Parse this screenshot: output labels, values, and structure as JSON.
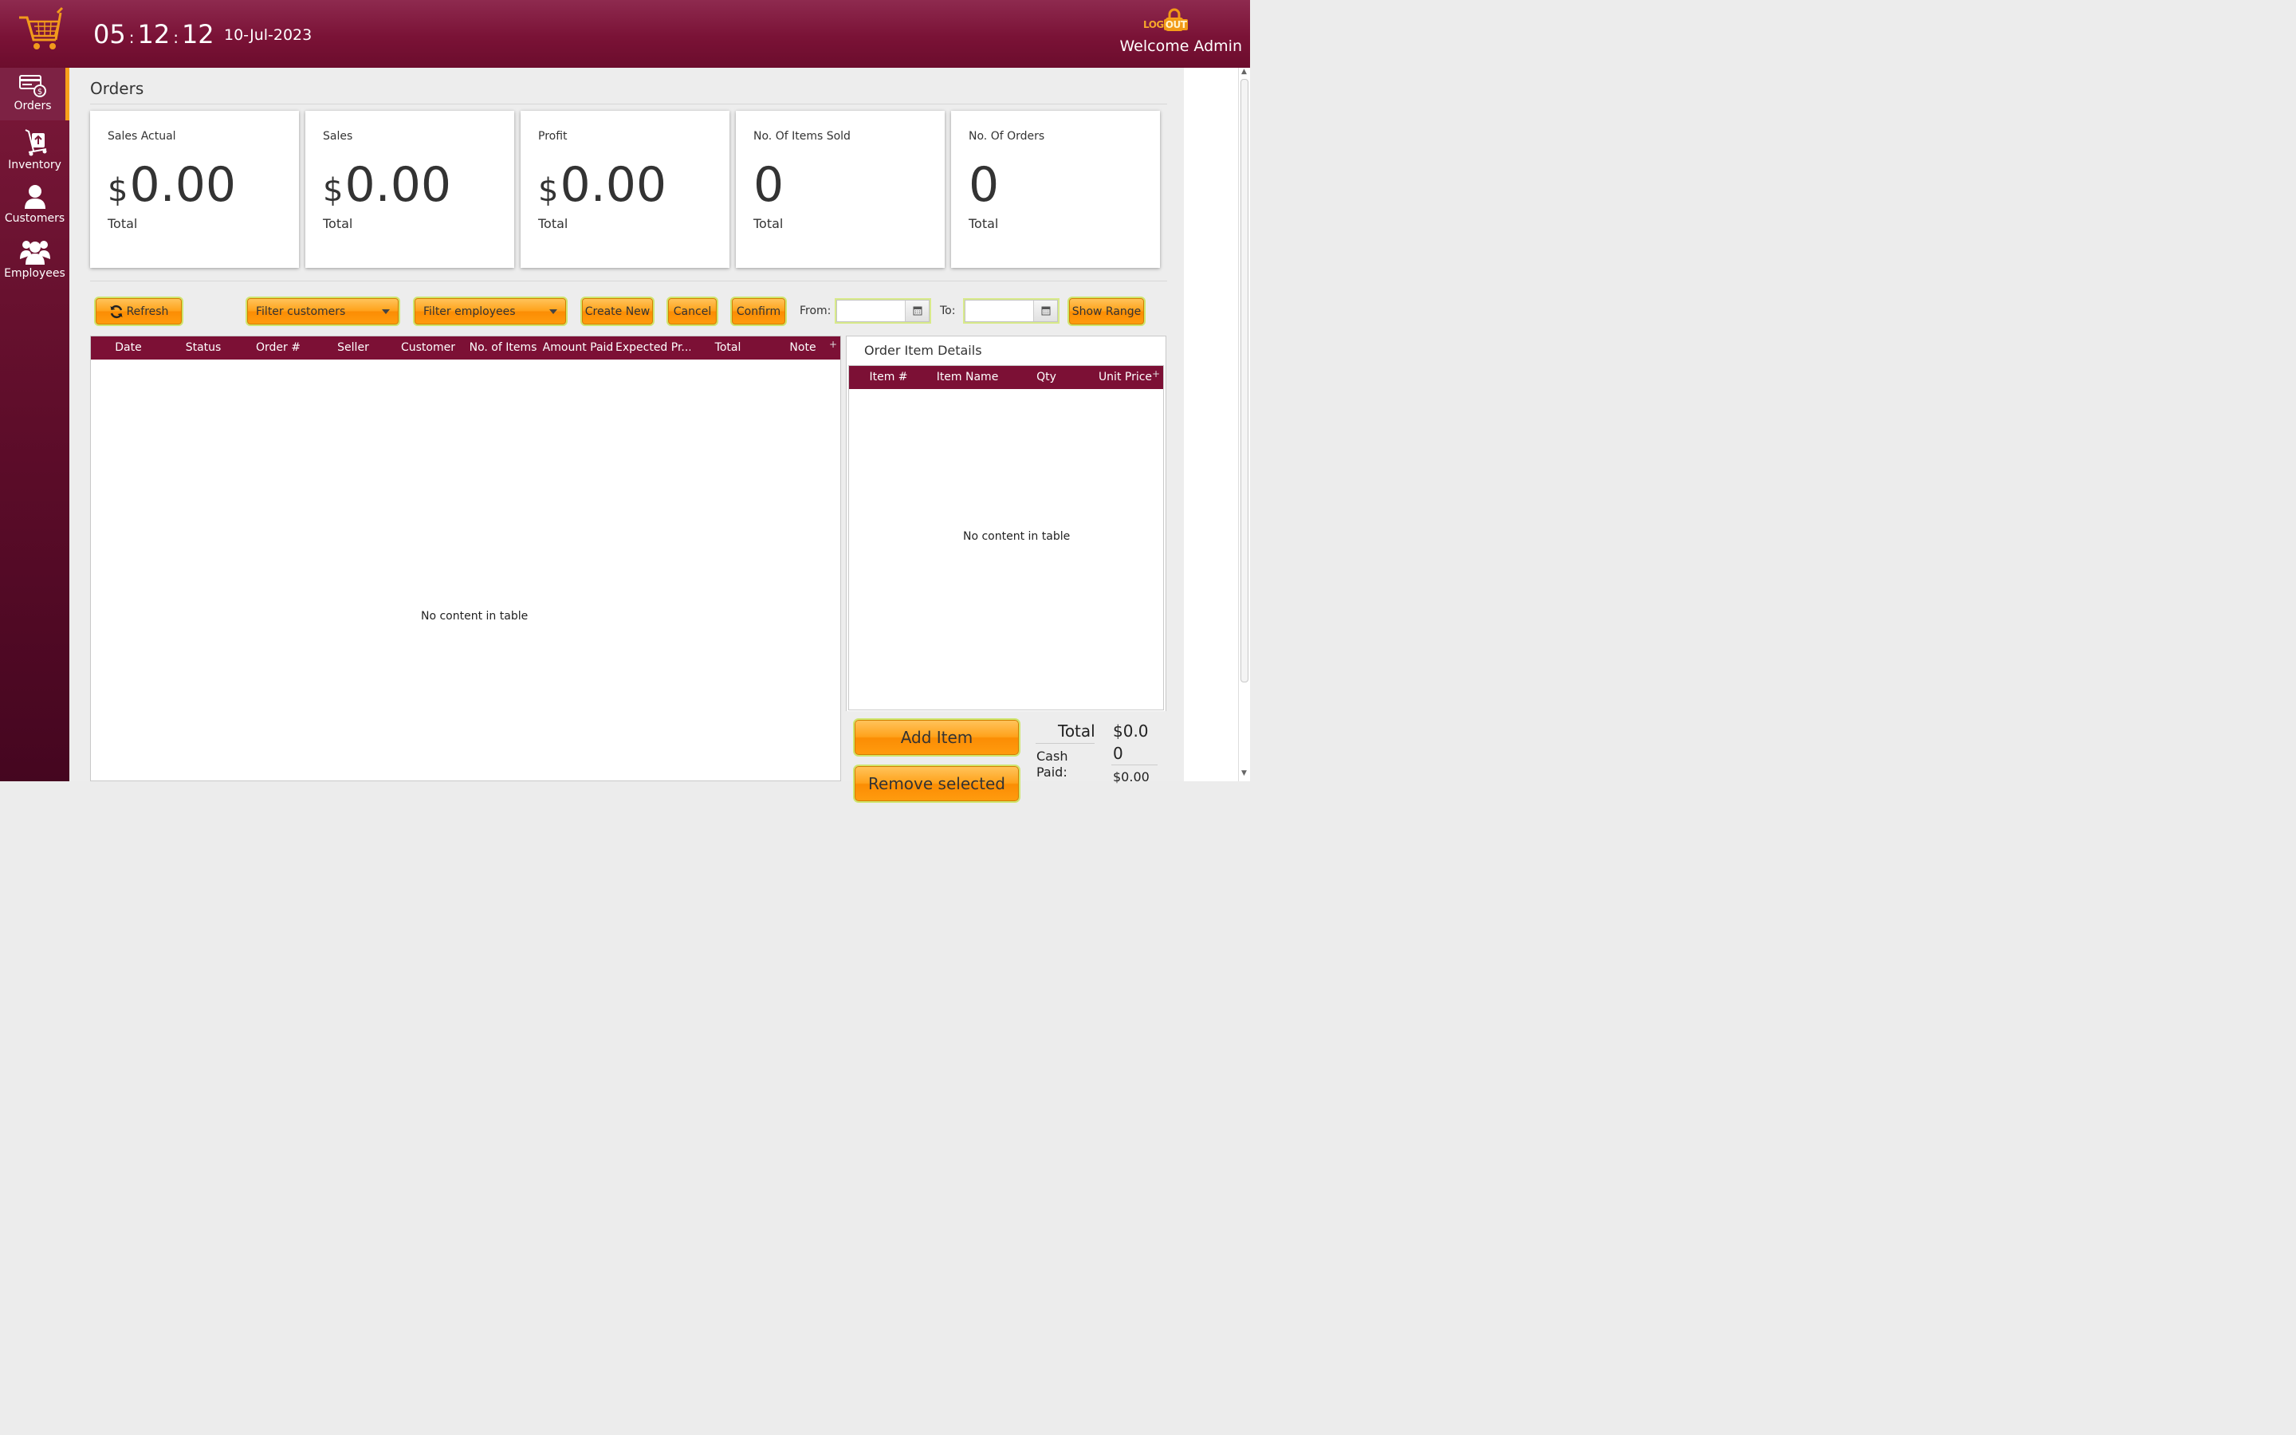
{
  "header": {
    "clock": {
      "hours": "05",
      "minutes": "12",
      "seconds": "12",
      "separator": ":"
    },
    "date": "10-Jul-2023",
    "logout": {
      "part1": "LOG",
      "part2": "OUT"
    },
    "welcome": "Welcome Admin"
  },
  "sidebar": {
    "items": [
      {
        "label": "Orders",
        "icon": "orders-icon",
        "active": true
      },
      {
        "label": "Inventory",
        "icon": "inventory-icon",
        "active": false
      },
      {
        "label": "Customers",
        "icon": "customer-icon",
        "active": false
      },
      {
        "label": "Employees",
        "icon": "employees-icon",
        "active": false
      }
    ]
  },
  "page": {
    "title": "Orders"
  },
  "stats": [
    {
      "caption": "Sales Actual",
      "currency": "$",
      "value": "0.00",
      "sub": "Total"
    },
    {
      "caption": "Sales",
      "currency": "$",
      "value": "0.00",
      "sub": "Total"
    },
    {
      "caption": "Profit",
      "currency": "$",
      "value": "0.00",
      "sub": "Total"
    },
    {
      "caption": "No. Of Items Sold",
      "currency": "",
      "value": "0",
      "sub": "Total"
    },
    {
      "caption": "No. Of Orders",
      "currency": "",
      "value": "0",
      "sub": "Total"
    }
  ],
  "toolbar": {
    "refresh": "Refresh",
    "filter_customers": "Filter customers",
    "filter_employees": "Filter employees",
    "create_new": "Create New",
    "cancel": "Cancel",
    "confirm": "Confirm",
    "from_label": "From:",
    "to_label": "To:",
    "from_value": "",
    "to_value": "",
    "show_range": "Show Range"
  },
  "orders_table": {
    "columns": [
      "Date",
      "Status",
      "Order #",
      "Seller",
      "Customer",
      "No. of Items",
      "Amount Paid",
      "Expected Pr...",
      "Total",
      "Note"
    ],
    "empty_message": "No content in table"
  },
  "order_details": {
    "title": "Order Item Details",
    "columns": [
      "Item #",
      "Item Name",
      "Qty",
      "Unit Price"
    ],
    "empty_message": "No content in table",
    "add_item": "Add Item",
    "remove_selected": "Remove selected",
    "total_label": "Total",
    "total_value_line1": "$0.0",
    "total_value_line2": "0",
    "cash_label_line1": "Cash",
    "cash_label_line2": "Paid:",
    "cash_value": "$0.00"
  },
  "colors": {
    "header_maroon": "#7a1236",
    "accent_orange": "#ffa21b",
    "table_header": "#7c1035"
  }
}
